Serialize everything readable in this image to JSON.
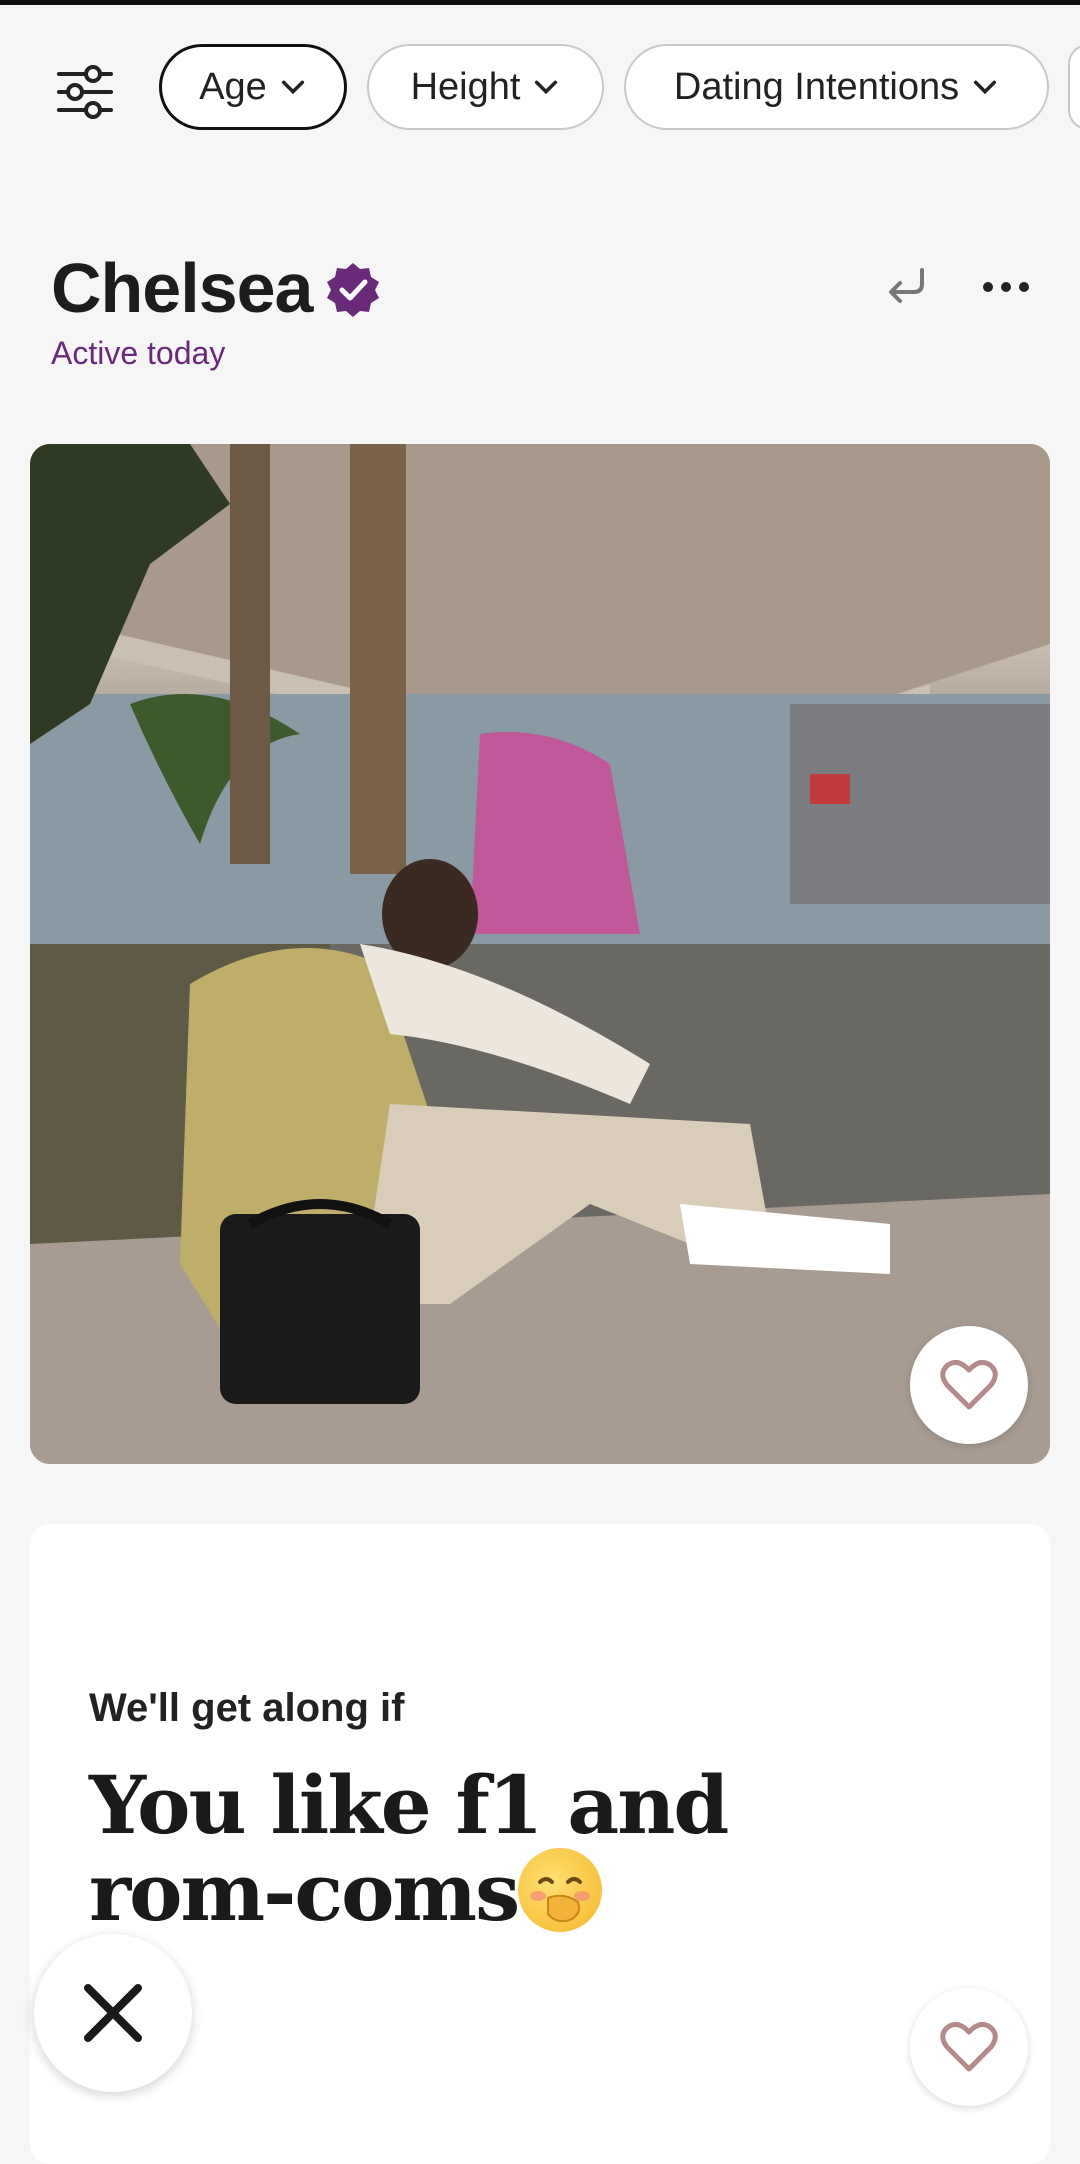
{
  "filters": {
    "chips": [
      {
        "label": "Age",
        "active": true
      },
      {
        "label": "Height",
        "active": false
      },
      {
        "label": "Dating Intentions",
        "active": false
      }
    ]
  },
  "profile": {
    "name": "Chelsea",
    "status": "Active today",
    "verified": true
  },
  "prompt": {
    "question": "We'll get along if",
    "answer": "You like f1 and rom-coms",
    "emoji": "face-with-hand-over-mouth"
  },
  "colors": {
    "accent_purple": "#6a2a7a",
    "like_heart": "#b58a8a"
  }
}
